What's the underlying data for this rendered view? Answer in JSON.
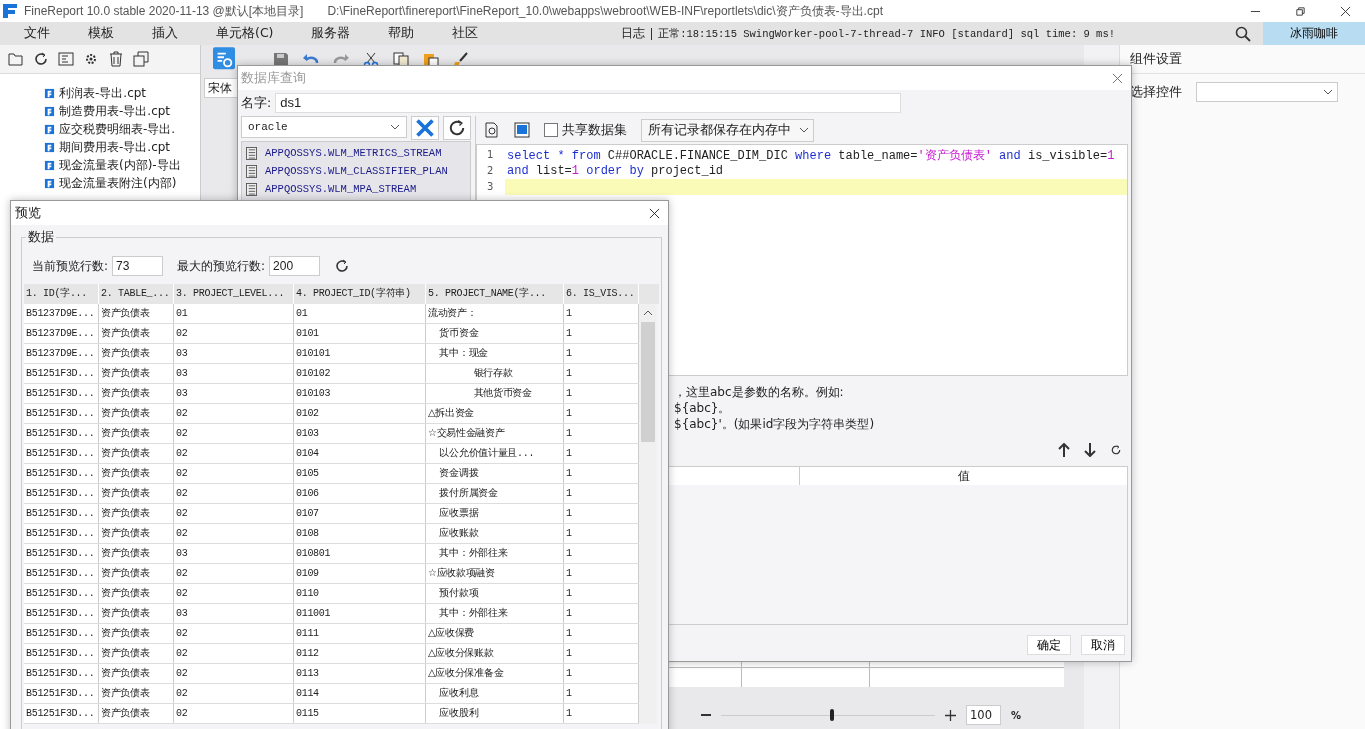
{
  "window": {
    "title": "FineReport 10.0 stable 2020-11-13 @默认[本地目录]",
    "path": "D:\\FineReport\\finereport\\FineReport_10.0\\webapps\\webroot\\WEB-INF\\reportlets\\dic\\资产负债表-导出.cpt"
  },
  "menu": [
    "文件",
    "模板",
    "插入",
    "单元格(C)",
    "服务器",
    "帮助",
    "社区"
  ],
  "log": {
    "label": "日志",
    "message": "正常:18:15:15 SwingWorker-pool-7-thread-7 INFO [standard] sql time: 9 ms!"
  },
  "user": "冰雨咖啡",
  "file_tree": [
    "利润表-导出.cpt",
    "制造费用表-导出.cpt",
    "应交税费明细表-导出.",
    "期间费用表-导出.cpt",
    "现金流量表(内部)-导出",
    "现金流量表附注(内部)"
  ],
  "editor": {
    "font": "宋体",
    "zoom": "100",
    "zoom_unit": "%",
    "zoom_slider": {
      "level": 0.52
    }
  },
  "right_panel": {
    "title": "组件设置",
    "select_label": "选择控件"
  },
  "query_dialog": {
    "title": "数据库查询",
    "name_label": "名字:",
    "name": "ds1",
    "connection": "oracle",
    "tables": [
      "APPQOSSYS.WLM_METRICS_STREAM",
      "APPQOSSYS.WLM_CLASSIFIER_PLAN",
      "APPQOSSYS.WLM_MPA_STREAM"
    ],
    "shared_label": "共享数据集",
    "shared": false,
    "storage": "所有记录都保存在内存中",
    "sql_lines": [
      {
        "number": "1",
        "current": false,
        "tokens": [
          {
            "text": "select",
            "kind": "keyword"
          },
          {
            "text": " * ",
            "kind": "keyword"
          },
          {
            "text": "from",
            "kind": "keyword"
          },
          {
            "text": " C##ORACLE.FINANCE_DIM_DIC ",
            "kind": "plain"
          },
          {
            "text": "where",
            "kind": "keyword"
          },
          {
            "text": " table_name=",
            "kind": "plain"
          },
          {
            "text": "'资产负债表'",
            "kind": "string"
          },
          {
            "text": " and",
            "kind": "keyword"
          },
          {
            "text": " is_visible=",
            "kind": "plain"
          },
          {
            "text": "1",
            "kind": "number"
          }
        ]
      },
      {
        "number": "2",
        "current": false,
        "tokens": [
          {
            "text": "and",
            "kind": "keyword"
          },
          {
            "text": " list=",
            "kind": "plain"
          },
          {
            "text": "1",
            "kind": "number"
          },
          {
            "text": " order by",
            "kind": "keyword"
          },
          {
            "text": " project_id",
            "kind": "plain"
          }
        ]
      },
      {
        "number": "3",
        "current": true
      }
    ],
    "help_lines": [
      "，这里abc是参数的名称。例如:",
      "${abc}。",
      "${abc}'。(如果id字段为字符串类型)"
    ],
    "param_columns": [
      "值"
    ],
    "buttons": [
      "确定",
      "取消"
    ]
  },
  "preview_dialog": {
    "title": "预览",
    "group": "数据",
    "current_label": "当前预览行数:",
    "current": "73",
    "max_label": "最大的预览行数:",
    "max": "200",
    "columns": [
      "1. ID(字...",
      "2. TABLE_...",
      "3. PROJECT_LEVEL...",
      "4. PROJECT_ID(字符串)",
      "5. PROJECT_NAME(字...",
      "6. IS_VIS..."
    ],
    "rows": [
      [
        "B51237D9E...",
        "资产负债表",
        "01",
        "01",
        "流动资产：",
        "1"
      ],
      [
        "B51237D9E...",
        "资产负债表",
        "02",
        "0101",
        "  货币资金",
        "1"
      ],
      [
        "B51237D9E...",
        "资产负债表",
        "03",
        "010101",
        "  其中：现金",
        "1"
      ],
      [
        "B51251F3D...",
        "资产负债表",
        "03",
        "010102",
        "        银行存款",
        "1"
      ],
      [
        "B51251F3D...",
        "资产负债表",
        "03",
        "010103",
        "        其他货币资金",
        "1"
      ],
      [
        "B51251F3D...",
        "资产负债表",
        "02",
        "0102",
        "△拆出资金",
        "1"
      ],
      [
        "B51251F3D...",
        "资产负债表",
        "02",
        "0103",
        "☆交易性金融资产",
        "1"
      ],
      [
        "B51251F3D...",
        "资产负债表",
        "02",
        "0104",
        "  以公允价值计量且...",
        "1"
      ],
      [
        "B51251F3D...",
        "资产负债表",
        "02",
        "0105",
        "  资金调拨",
        "1"
      ],
      [
        "B51251F3D...",
        "资产负债表",
        "02",
        "0106",
        "  拨付所属资金",
        "1"
      ],
      [
        "B51251F3D...",
        "资产负债表",
        "02",
        "0107",
        "  应收票据",
        "1"
      ],
      [
        "B51251F3D...",
        "资产负债表",
        "02",
        "0108",
        "  应收账款",
        "1"
      ],
      [
        "B51251F3D...",
        "资产负债表",
        "03",
        "010801",
        "  其中：外部往来",
        "1"
      ],
      [
        "B51251F3D...",
        "资产负债表",
        "02",
        "0109",
        "☆应收款项融资",
        "1"
      ],
      [
        "B51251F3D...",
        "资产负债表",
        "02",
        "0110",
        "  预付款项",
        "1"
      ],
      [
        "B51251F3D...",
        "资产负债表",
        "03",
        "011001",
        "  其中：外部往来",
        "1"
      ],
      [
        "B51251F3D...",
        "资产负债表",
        "02",
        "0111",
        "△应收保费",
        "1"
      ],
      [
        "B51251F3D...",
        "资产负债表",
        "02",
        "0112",
        "△应收分保账款",
        "1"
      ],
      [
        "B51251F3D...",
        "资产负债表",
        "02",
        "0113",
        "△应收分保准备金",
        "1"
      ],
      [
        "B51251F3D...",
        "资产负债表",
        "02",
        "0114",
        "  应收利息",
        "1"
      ],
      [
        "B51251F3D...",
        "资产负债表",
        "02",
        "0115",
        "  应收股利",
        "1"
      ]
    ]
  }
}
